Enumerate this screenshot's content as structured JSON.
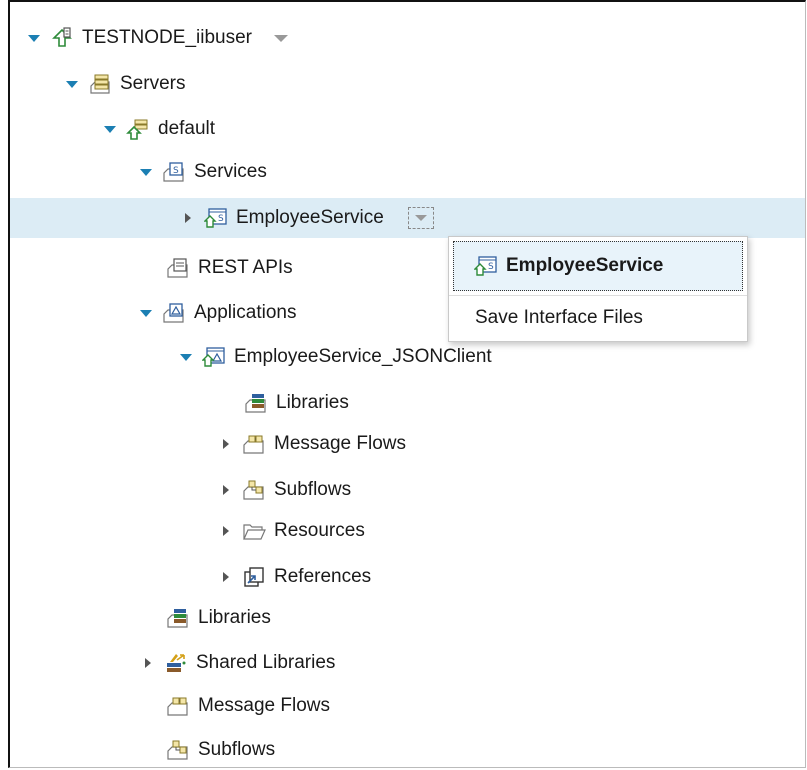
{
  "tree": {
    "node": {
      "label": "TESTNODE_iibuser",
      "expanded": true
    },
    "servers": {
      "label": "Servers",
      "expanded": true
    },
    "default": {
      "label": "default",
      "expanded": true
    },
    "services": {
      "label": "Services",
      "expanded": true
    },
    "employee_service": {
      "label": "EmployeeService",
      "expanded": false,
      "selected": true
    },
    "rest_apis": {
      "label": "REST APIs"
    },
    "applications": {
      "label": "Applications",
      "expanded": true
    },
    "json_client": {
      "label": "EmployeeService_JSONClient",
      "expanded": true
    },
    "app_libraries": {
      "label": "Libraries"
    },
    "app_message_flows": {
      "label": "Message Flows",
      "expanded": false
    },
    "app_subflows": {
      "label": "Subflows",
      "expanded": false
    },
    "app_resources": {
      "label": "Resources",
      "expanded": false
    },
    "app_references": {
      "label": "References",
      "expanded": false
    },
    "libraries": {
      "label": "Libraries"
    },
    "shared_libraries": {
      "label": "Shared Libraries",
      "expanded": false
    },
    "message_flows": {
      "label": "Message Flows"
    },
    "subflows": {
      "label": "Subflows"
    }
  },
  "popup": {
    "title": "EmployeeService",
    "items": [
      {
        "label": "Save Interface Files"
      }
    ]
  },
  "colors": {
    "selection": "#dcecf5",
    "twisty_expanded": "#1b7fb3",
    "icon_green": "#2e8b3a",
    "icon_blue": "#2f5f9e"
  }
}
